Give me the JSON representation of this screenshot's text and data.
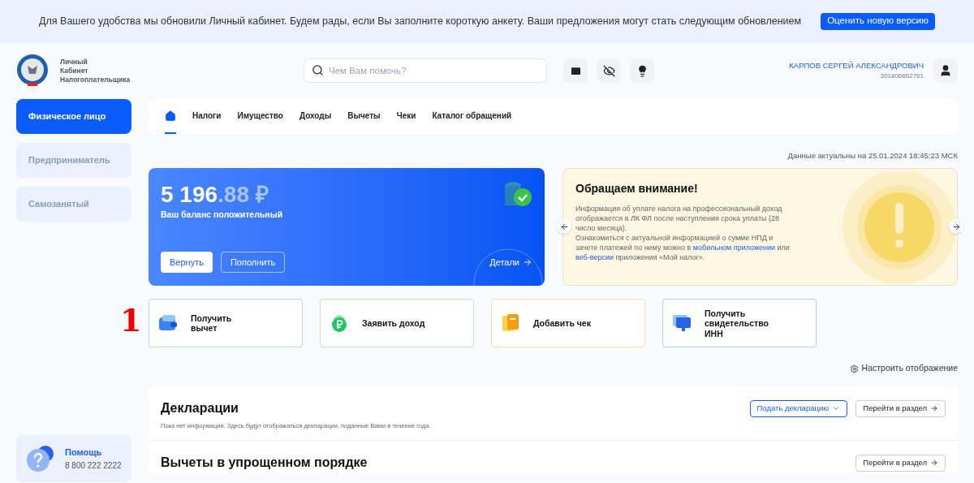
{
  "banner": {
    "text": "Для Вашего удобства мы обновили Личный кабинет. Будем рады, если Вы заполните короткую анкету. Ваши предложения могут стать следующим обновлением",
    "button": "Оценить новую версию"
  },
  "header": {
    "logo_lines": [
      "Личный",
      "Кабинет",
      "Налогоплательщика"
    ],
    "search": {
      "placeholder": "Чем Вам помочь?"
    },
    "user_name": "КАРПОВ СЕРГЕЙ АЛЕКСАНДРОВИЧ",
    "inn": "301806662761"
  },
  "sidebar": {
    "items": [
      {
        "label": "Физическое лицо",
        "selected": true
      },
      {
        "label": "Предприниматель",
        "selected": false
      },
      {
        "label": "Самозанятый",
        "selected": false
      }
    ],
    "help": {
      "title": "Помощь",
      "phone": "8 800 222 2222"
    }
  },
  "tabs": [
    {
      "kind": "home",
      "selected": true
    },
    {
      "label": "Налоги",
      "selected": false
    },
    {
      "label": "Имущество",
      "selected": false
    },
    {
      "label": "Доходы",
      "selected": false
    },
    {
      "label": "Вычеты",
      "selected": false
    },
    {
      "label": "Чеки",
      "selected": false
    },
    {
      "label": "Каталог обращений",
      "selected": false
    }
  ],
  "updated": "Данные актуальны на 25.01.2024 18:45:23 МСК",
  "balance": {
    "amount_whole": "5 196",
    "amount_fraction": ".88 ₽",
    "caption": "Ваш баланс положительный",
    "buttons": [
      "Вернуть",
      "Пополнить"
    ],
    "details": "Детали"
  },
  "notice": {
    "title": "Обращаем внимание!",
    "text": "Информация об уплате налога на профессиональный доход отображается в ЛК ФЛ после наступления срока уплаты (28 число месяца).",
    "text2_start": "Ознакомиться с актуальной информацией о сумме НПД и зачете платежей по нему можно в",
    "link1": "мобильном приложении",
    "text2_mid": "или",
    "link2": "веб-версии",
    "text2_end": "приложения «Мой налог»."
  },
  "annotation": "1",
  "actions": [
    {
      "kind": "wallet",
      "label": "Получить вычет",
      "color": "#3b82f6"
    },
    {
      "kind": "ruble",
      "label": "Заявить доход",
      "color": "#22c55e"
    },
    {
      "kind": "receipt",
      "label": "Добавить чек",
      "color": "#f59e0b"
    },
    {
      "kind": "monitor",
      "label": "Получить свидетельство ИНН",
      "color": "#2563eb"
    }
  ],
  "customize": "Настроить отображение",
  "declarations": {
    "title": "Декларации",
    "submit": "Подать декларацию",
    "goto": "Перейти в раздел",
    "empty": "Пока нет информации. Здесь будут отображаться декларации, поданные Вами в течение года."
  },
  "deductions": {
    "title": "Вычеты в упрощенном порядке",
    "goto": "Перейти в раздел"
  }
}
